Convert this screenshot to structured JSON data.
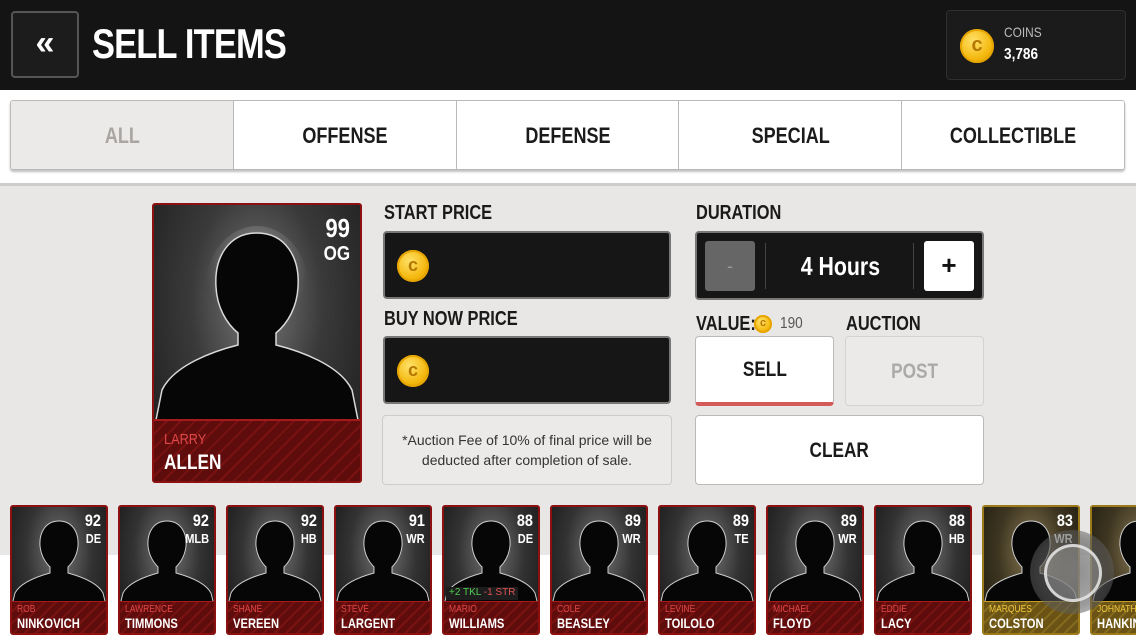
{
  "header": {
    "back_label": "«",
    "title": "SELL ITEMS",
    "coins_label": "COINS",
    "coins_value": "3,786"
  },
  "tabs": [
    {
      "label": "ALL",
      "active": true
    },
    {
      "label": "OFFENSE"
    },
    {
      "label": "DEFENSE"
    },
    {
      "label": "SPECIAL"
    },
    {
      "label": "COLLECTIBLE"
    }
  ],
  "selected_card": {
    "rating": "99",
    "position": "OG",
    "first_name": "LARRY",
    "last_name": "ALLEN"
  },
  "form": {
    "start_price_label": "START PRICE",
    "start_price_value": "",
    "buy_now_label": "BUY NOW PRICE",
    "buy_now_value": "",
    "fee_note": "*Auction Fee of 10% of final price will be deducted after completion of sale.",
    "duration_label": "DURATION",
    "duration_value": "4 Hours",
    "minus_label": "-",
    "plus_label": "+",
    "value_label": "VALUE:",
    "value_amount": "190",
    "auction_label": "AUCTION",
    "sell_label": "SELL",
    "post_label": "POST",
    "clear_label": "CLEAR"
  },
  "roster": [
    {
      "rating": "92",
      "position": "DE",
      "first": "ROB",
      "last": "NINKOVICH",
      "tier": "red"
    },
    {
      "rating": "92",
      "position": "MLB",
      "first": "LAWRENCE",
      "last": "TIMMONS",
      "tier": "red"
    },
    {
      "rating": "92",
      "position": "HB",
      "first": "SHANE",
      "last": "VEREEN",
      "tier": "red"
    },
    {
      "rating": "91",
      "position": "WR",
      "first": "STEVE",
      "last": "LARGENT",
      "tier": "red"
    },
    {
      "rating": "88",
      "position": "DE",
      "first": "MARIO",
      "last": "WILLIAMS",
      "tier": "red",
      "boost_up": "+2 TKL",
      "boost_down": "-1 STR"
    },
    {
      "rating": "89",
      "position": "WR",
      "first": "COLE",
      "last": "BEASLEY",
      "tier": "red"
    },
    {
      "rating": "89",
      "position": "TE",
      "first": "LEVINE",
      "last": "TOILOLO",
      "tier": "red"
    },
    {
      "rating": "89",
      "position": "WR",
      "first": "MICHAEL",
      "last": "FLOYD",
      "tier": "red"
    },
    {
      "rating": "88",
      "position": "HB",
      "first": "EDDIE",
      "last": "LACY",
      "tier": "red"
    },
    {
      "rating": "83",
      "position": "WR",
      "first": "MARQUES",
      "last": "COLSTON",
      "tier": "gold"
    },
    {
      "rating": "",
      "position": "",
      "first": "JOHNATHAN",
      "last": "HANKINS",
      "tier": "gold"
    }
  ],
  "icons": {
    "coin": "coin-icon",
    "back": "double-chevron-left-icon",
    "assist": "assistive-touch-icon"
  },
  "colors": {
    "header_bg": "#141414",
    "card_red": "#8c1010",
    "card_gold": "#9c7a1a",
    "coin": "#f4b80d",
    "sell_underline": "#d45a5a"
  }
}
